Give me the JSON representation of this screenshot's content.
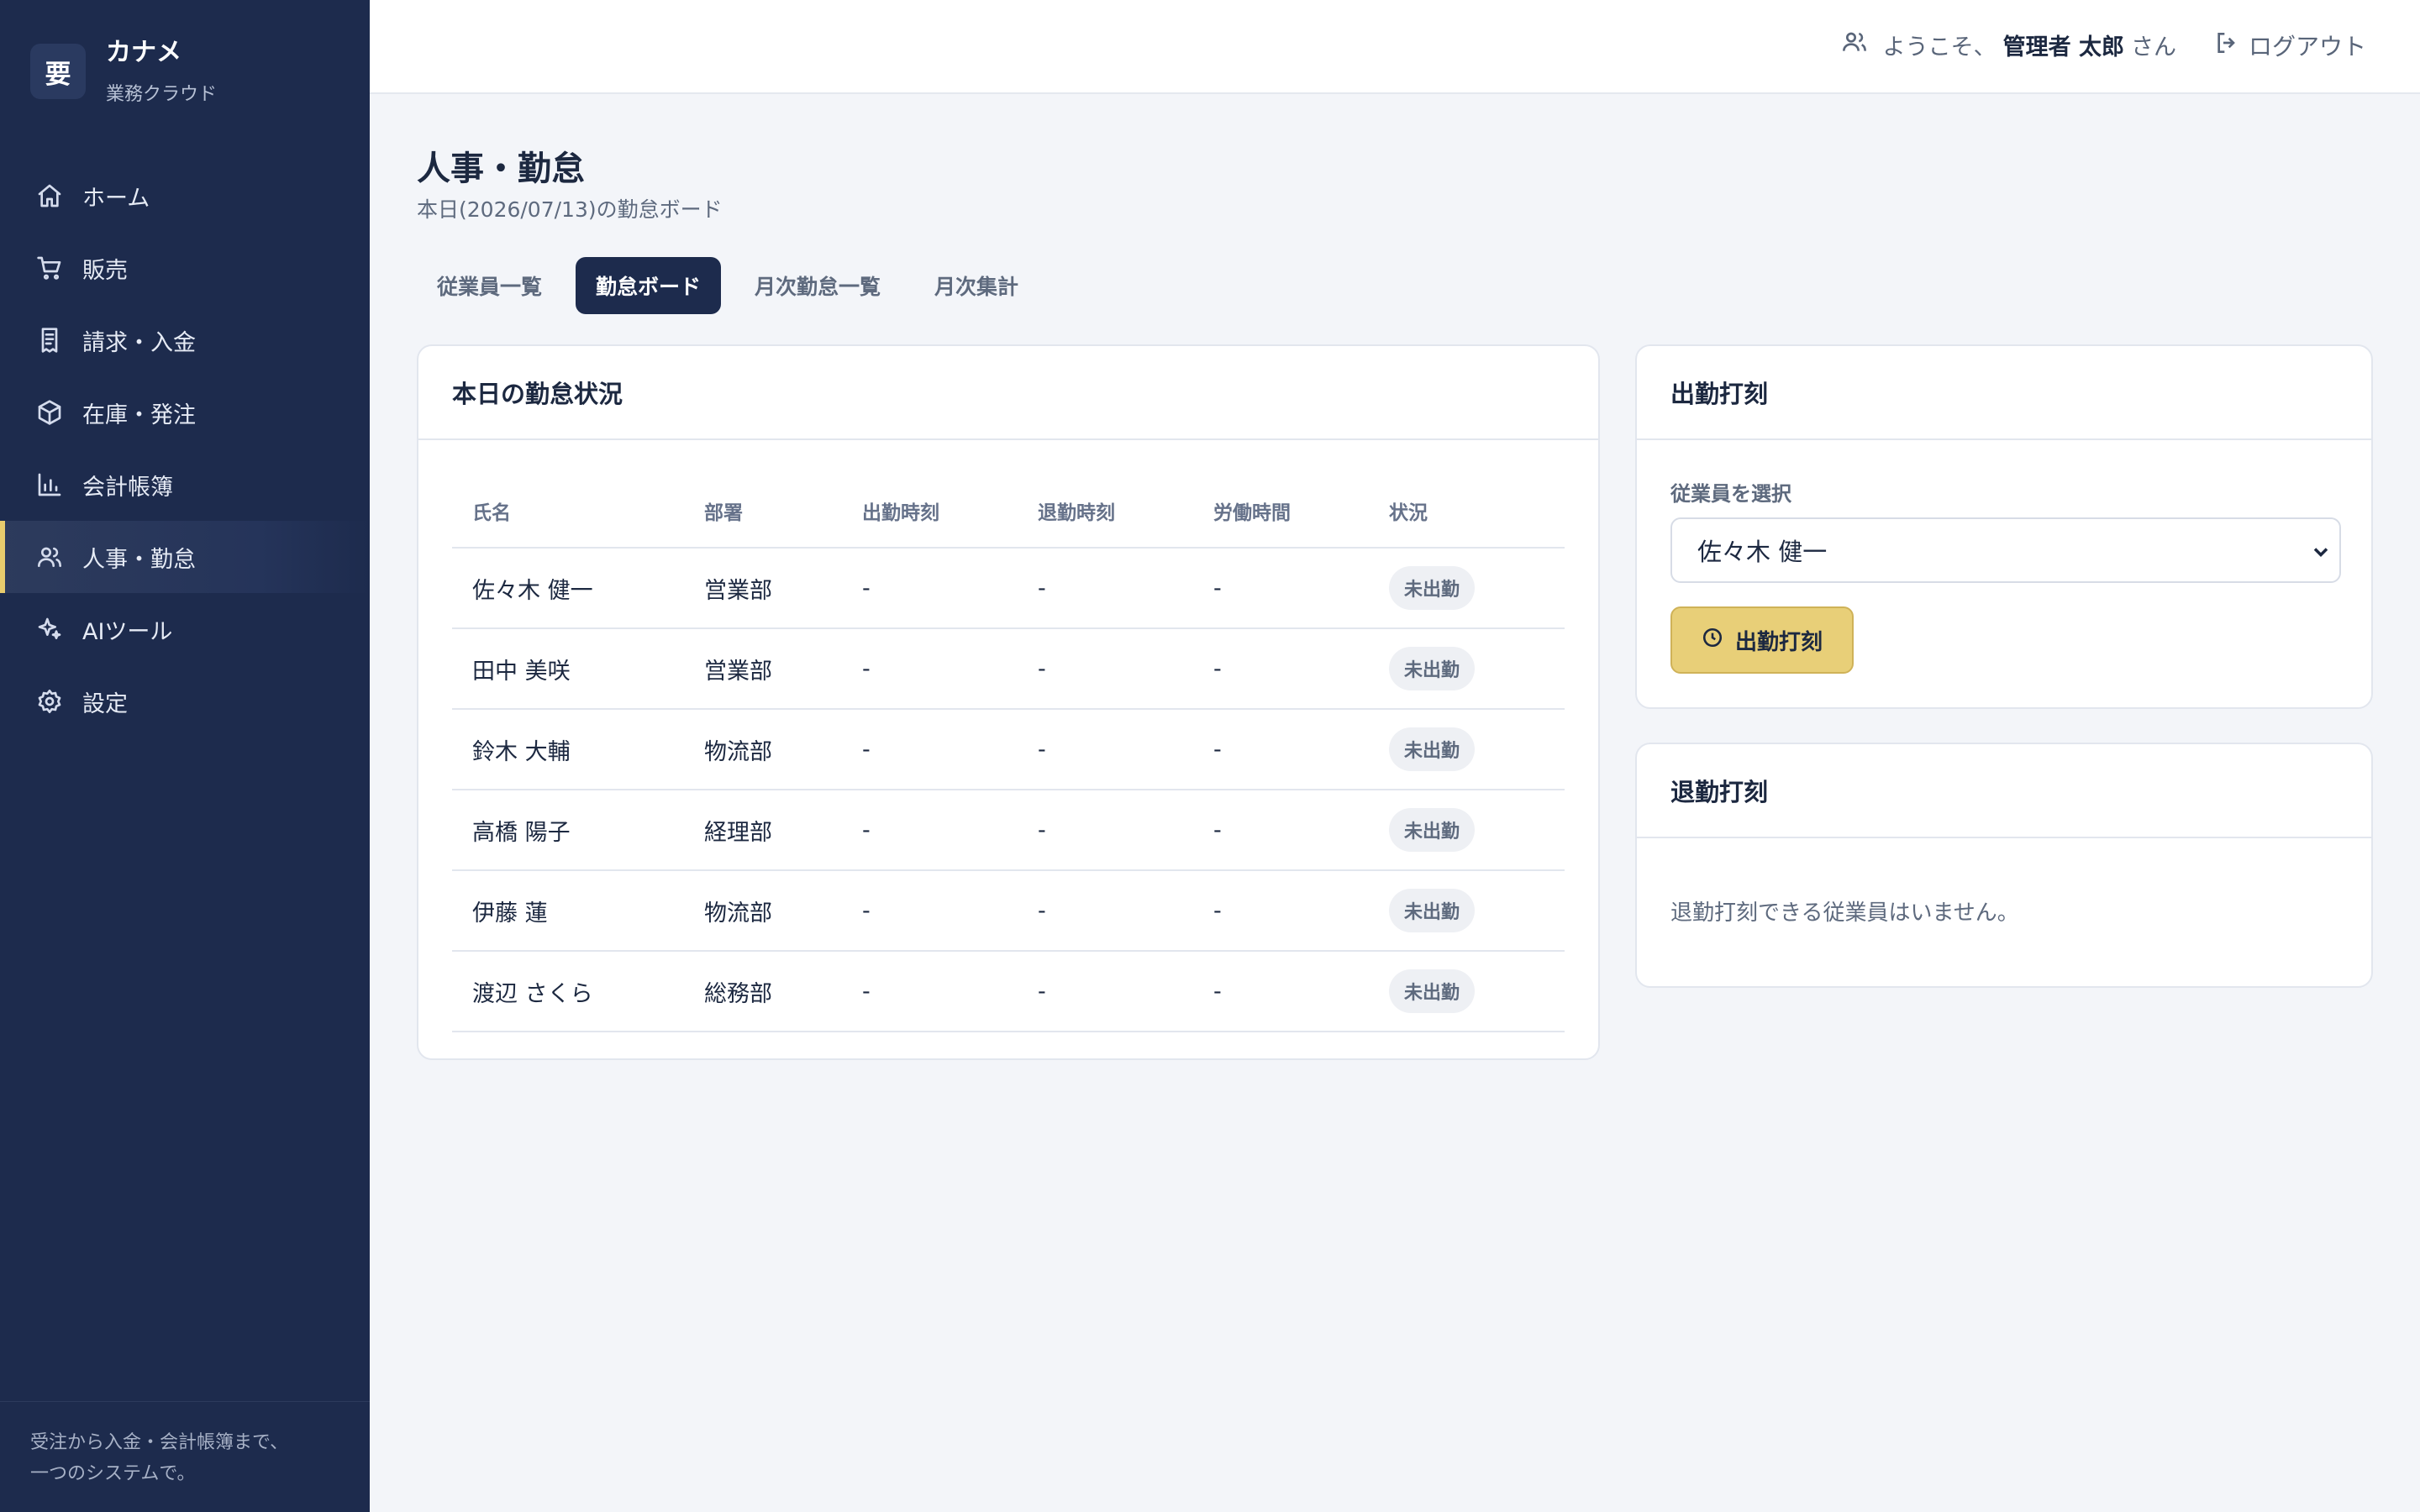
{
  "brand": {
    "logo": "要",
    "name": "カナメ",
    "subtitle": "業務クラウド"
  },
  "sidebar": {
    "items": [
      {
        "label": "ホーム",
        "icon": "home-icon"
      },
      {
        "label": "販売",
        "icon": "cart-icon"
      },
      {
        "label": "請求・入金",
        "icon": "receipt-icon"
      },
      {
        "label": "在庫・発注",
        "icon": "box-icon"
      },
      {
        "label": "会計帳簿",
        "icon": "bar-chart-icon"
      },
      {
        "label": "人事・勤怠",
        "icon": "users-icon",
        "active": true
      },
      {
        "label": "AIツール",
        "icon": "sparkles-icon"
      },
      {
        "label": "設定",
        "icon": "gear-icon"
      }
    ],
    "footer_line1": "受注から入金・会計帳簿まで、",
    "footer_line2": "一つのシステムで。"
  },
  "header": {
    "welcome_prefix": "ようこそ、",
    "user_name": "管理者 太郎",
    "welcome_suffix": "さん",
    "logout_label": "ログアウト"
  },
  "page": {
    "title": "人事・勤怠",
    "subtitle": "本日(2026/07/13)の勤怠ボード"
  },
  "tabs": [
    {
      "label": "従業員一覧"
    },
    {
      "label": "勤怠ボード",
      "active": true
    },
    {
      "label": "月次勤怠一覧"
    },
    {
      "label": "月次集計"
    }
  ],
  "attendance": {
    "title": "本日の勤怠状況",
    "columns": [
      "氏名",
      "部署",
      "出勤時刻",
      "退勤時刻",
      "労働時間",
      "状況"
    ],
    "rows": [
      {
        "name": "佐々木 健一",
        "dept": "営業部",
        "in": "-",
        "out": "-",
        "hours": "-",
        "status": "未出勤"
      },
      {
        "name": "田中 美咲",
        "dept": "営業部",
        "in": "-",
        "out": "-",
        "hours": "-",
        "status": "未出勤"
      },
      {
        "name": "鈴木 大輔",
        "dept": "物流部",
        "in": "-",
        "out": "-",
        "hours": "-",
        "status": "未出勤"
      },
      {
        "name": "高橋 陽子",
        "dept": "経理部",
        "in": "-",
        "out": "-",
        "hours": "-",
        "status": "未出勤"
      },
      {
        "name": "伊藤 蓮",
        "dept": "物流部",
        "in": "-",
        "out": "-",
        "hours": "-",
        "status": "未出勤"
      },
      {
        "name": "渡辺 さくら",
        "dept": "総務部",
        "in": "-",
        "out": "-",
        "hours": "-",
        "status": "未出勤"
      }
    ]
  },
  "clock_in": {
    "title": "出勤打刻",
    "select_label": "従業員を選択",
    "selected_employee": "佐々木 健一",
    "button_label": "出勤打刻"
  },
  "clock_out": {
    "title": "退勤打刻",
    "empty_message": "退勤打刻できる従業員はいません。"
  },
  "colors": {
    "sidebar_bg": "#1d2b4d",
    "accent": "#e8cf78",
    "page_bg": "#f3f5f9"
  }
}
